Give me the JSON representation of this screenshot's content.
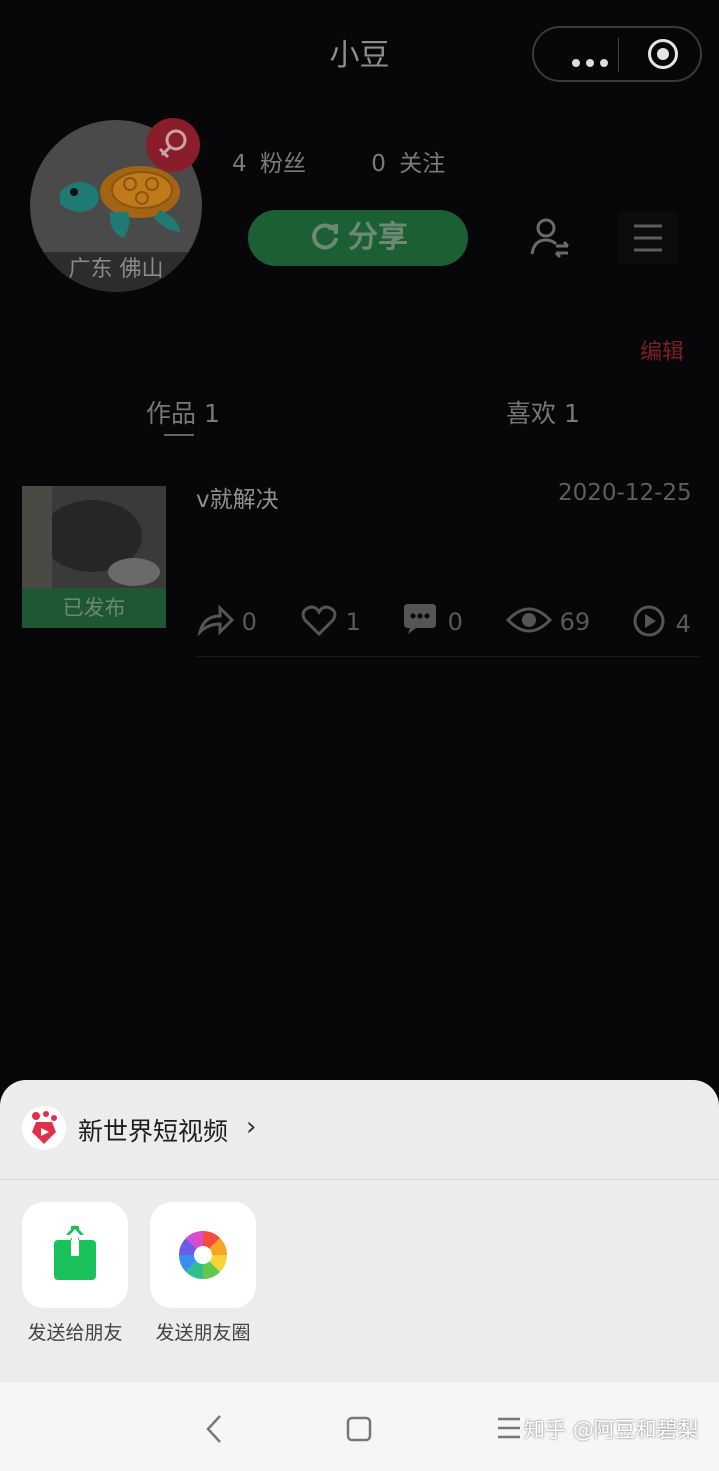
{
  "header": {
    "title": "小豆"
  },
  "profile": {
    "location": "广东 佛山",
    "fans_count": "4",
    "fans_label": "粉丝",
    "following_count": "0",
    "following_label": "关注",
    "share_label": "分享",
    "edit_label": "编辑"
  },
  "tabs": [
    {
      "label": "作品 1"
    },
    {
      "label": "喜欢 1"
    }
  ],
  "video": {
    "title": "v就解决",
    "date": "2020-12-25",
    "status": "已发布",
    "shares": "0",
    "likes": "1",
    "comments": "0",
    "views": "69",
    "plays": "4"
  },
  "sheet": {
    "app_name": "新世界短视频",
    "options": [
      {
        "label": "发送给朋友",
        "icon": "share-to-friend-icon",
        "color": "#18c159"
      },
      {
        "label": "发送朋友圈",
        "icon": "moments-aperture-icon"
      }
    ]
  },
  "watermark": "知乎 @阿豆和碧梨",
  "colors": {
    "accent_green": "#18c159",
    "share_button": "#1d5f34",
    "gender_badge": "#8a1d2a"
  }
}
